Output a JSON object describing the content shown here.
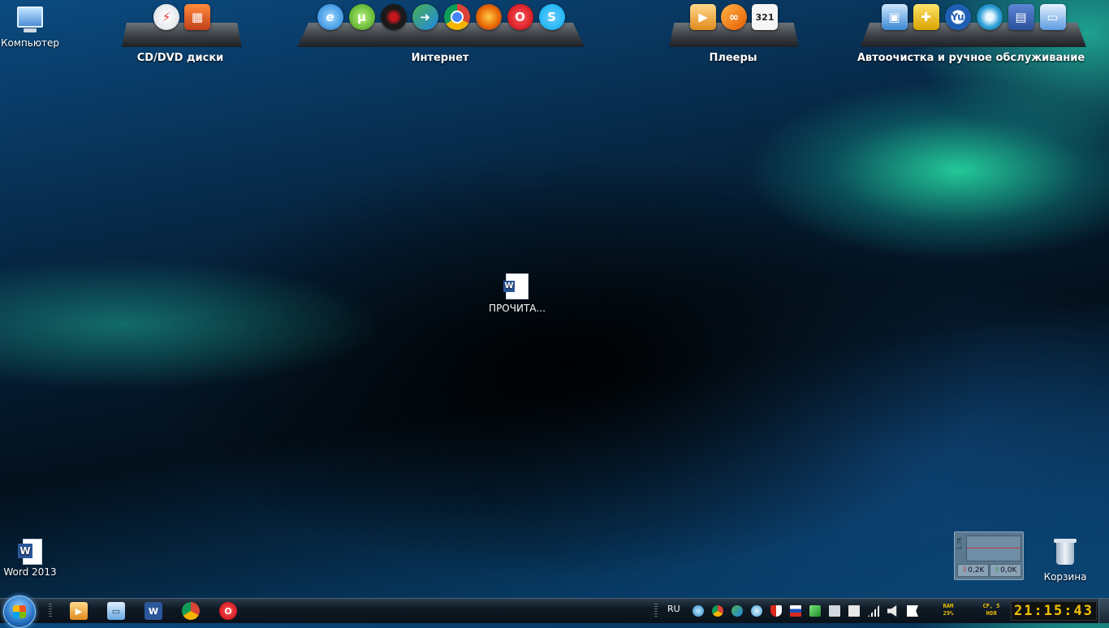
{
  "desktop": {
    "icons": [
      {
        "label": "Компьютер",
        "icon": "computer-icon"
      },
      {
        "label": "ПРОЧИТА...",
        "icon": "word-document-icon"
      },
      {
        "label": "Word 2013",
        "icon": "word-2013-icon"
      },
      {
        "label": "Корзина",
        "icon": "recycle-bin-icon"
      }
    ]
  },
  "docks": [
    {
      "label": "CD/DVD диски",
      "icons": [
        "burnaware-icon",
        "disc-image-icon"
      ]
    },
    {
      "label": "Интернет",
      "icons": [
        "internet-explorer-icon",
        "utorrent-icon",
        "media-get-icon",
        "internet-download-manager-icon",
        "chrome-icon",
        "firefox-icon",
        "opera-icon",
        "skype-icon"
      ]
    },
    {
      "label": "Плееры",
      "icons": [
        "media-player-icon",
        "aimp-icon",
        "media-player-classic-icon"
      ]
    },
    {
      "label": "Автоочистка и ручное обслуживание",
      "icons": [
        "control-panel-icon",
        "system-tools-icon",
        "yu-icon",
        "disc-cleanup-icon",
        "floppy-backup-icon",
        "system-info-icon"
      ]
    }
  ],
  "netmon": {
    "scale": "1,7K",
    "down": "0,2K",
    "up": "0,0K"
  },
  "taskbar": {
    "apps": [
      "media-player-icon",
      "remote-desktop-icon",
      "word-icon",
      "chrome-icon",
      "opera-icon"
    ],
    "language": "RU",
    "ram_label": "RAM",
    "ram_value": "29%",
    "date_day": "СР, 5",
    "date_month": "НОЯ",
    "time": "21:15:43"
  }
}
